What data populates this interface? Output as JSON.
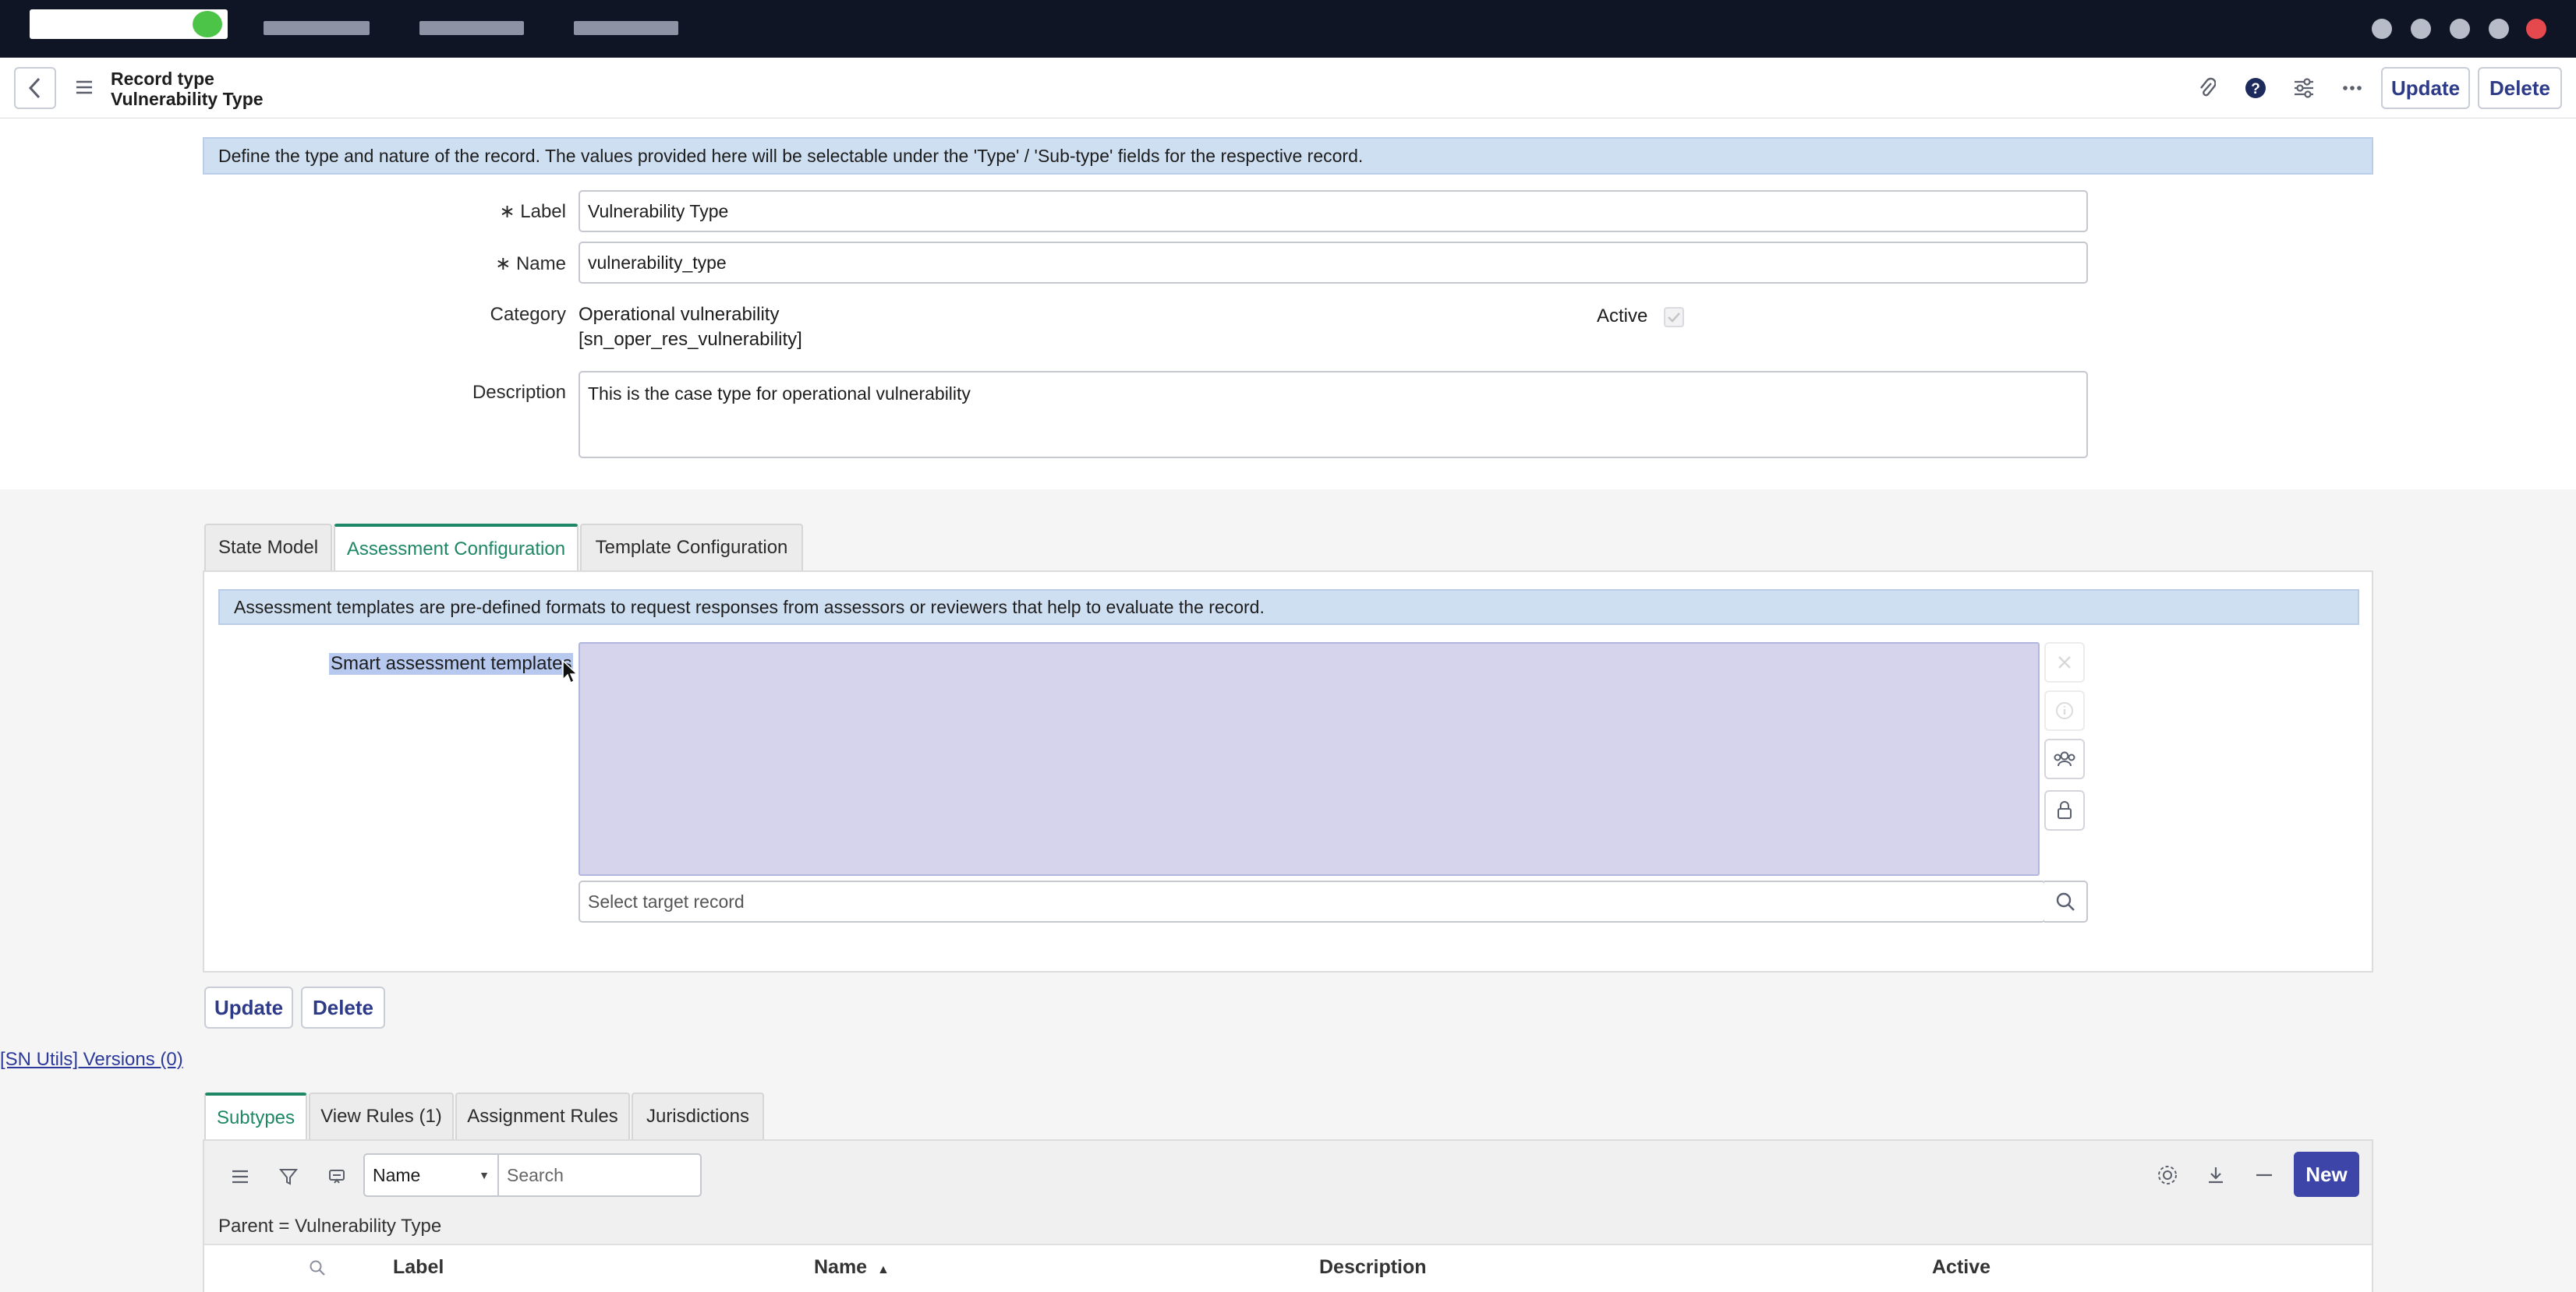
{
  "header": {
    "record_type_label": "Record type",
    "record_name": "Vulnerability Type",
    "update_label": "Update",
    "delete_label": "Delete"
  },
  "form": {
    "info_banner": "Define the type and nature of the record. The values provided here will be selectable under the 'Type' / 'Sub-type' fields for the respective record.",
    "required_marker": "∗",
    "label_field": {
      "label": "Label",
      "value": "Vulnerability Type"
    },
    "name_field": {
      "label": "Name",
      "value": "vulnerability_type"
    },
    "category": {
      "label": "Category",
      "value": "Operational vulnerability",
      "table": "[sn_oper_res_vulnerability]"
    },
    "active": {
      "label": "Active",
      "checked": true
    },
    "description": {
      "label": "Description",
      "value": "This is the case type for operational vulnerability"
    }
  },
  "section_tabs": [
    {
      "label": "State Model"
    },
    {
      "label": "Assessment Configuration",
      "active": true
    },
    {
      "label": "Template Configuration"
    }
  ],
  "assessment": {
    "info_banner": "Assessment templates are pre-defined formats to request responses from assessors or reviewers that help to evaluate the record.",
    "smart_label": "Smart assessment templates",
    "select_placeholder": "Select target record"
  },
  "bottom_buttons": {
    "update_label": "Update",
    "delete_label": "Delete"
  },
  "sn_utils_link": "[SN Utils] Versions (0)",
  "related_tabs": [
    {
      "label": "Subtypes",
      "active": true
    },
    {
      "label": "View Rules (1)"
    },
    {
      "label": "Assignment Rules"
    },
    {
      "label": "Jurisdictions"
    }
  ],
  "list": {
    "field_select": "Name",
    "search_placeholder": "Search",
    "new_label": "New",
    "breadcrumb": "Parent = Vulnerability Type",
    "columns": [
      {
        "label": "Label"
      },
      {
        "label": "Name",
        "sort": "▲"
      },
      {
        "label": "Description"
      },
      {
        "label": "Active"
      }
    ]
  },
  "colors": {
    "nav_bg": "#0f1525",
    "accent_green": "#1e8765",
    "primary_button": "#3d45a8",
    "banner_blue": "#cfdff2"
  }
}
